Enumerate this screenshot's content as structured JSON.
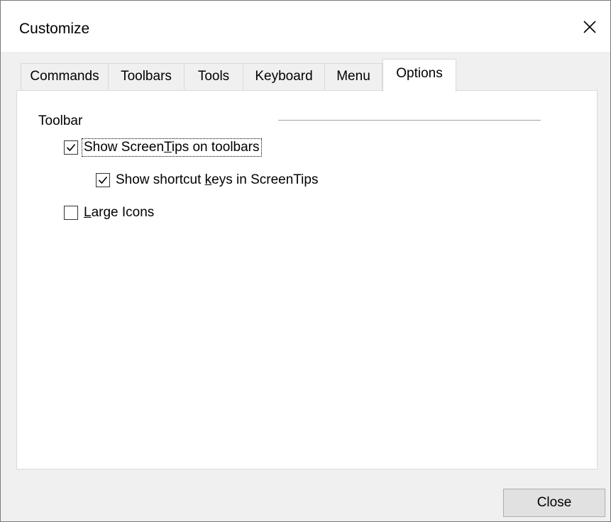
{
  "window": {
    "title": "Customize"
  },
  "tabs": [
    {
      "label": "Commands",
      "active": false
    },
    {
      "label": "Toolbars",
      "active": false
    },
    {
      "label": "Tools",
      "active": false
    },
    {
      "label": "Keyboard",
      "active": false
    },
    {
      "label": "Menu",
      "active": false
    },
    {
      "label": "Options",
      "active": true
    }
  ],
  "options": {
    "group_label": "Toolbar",
    "show_screentips": {
      "before": "Show Screen",
      "mnemonic": "T",
      "after": "ips on toolbars",
      "checked": true
    },
    "show_shortcut_keys": {
      "before": "Show shortcut ",
      "mnemonic": "k",
      "after": "eys in ScreenTips",
      "checked": true
    },
    "large_icons": {
      "before": "",
      "mnemonic": "L",
      "after": "arge Icons",
      "checked": false
    }
  },
  "footer": {
    "close_label": "Close"
  },
  "icons": {
    "close": "close-icon",
    "check": "checkmark-icon"
  }
}
